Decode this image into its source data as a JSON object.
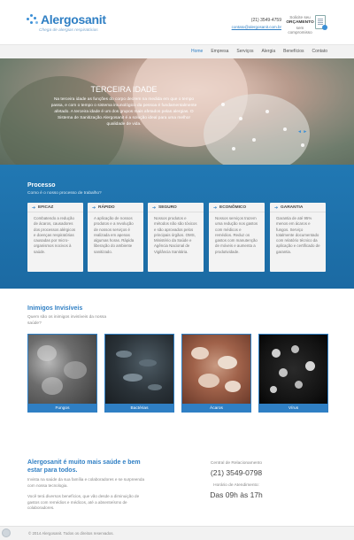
{
  "header": {
    "brand": "Alergosanit",
    "slogan": "Chega de alergias respiratórias",
    "phone": "(21) 3549-4759",
    "email": "contato@alergosanit.com.br",
    "quote_line1": "Solicite seu",
    "quote_line2": "ORÇAMENTO",
    "quote_line3": "sem compromisso",
    "quote_icon": "document-icon"
  },
  "nav": {
    "items": [
      "Home",
      "Empresa",
      "Serviços",
      "Alergia",
      "Benefícios",
      "Contato"
    ],
    "active": "Home"
  },
  "hero": {
    "title": "TERCEIRA IDADE",
    "text": "Na terceira idade as funções do corpo decrem na medida em que o tempo passa, e com o tempo o sistema imunológico da pessoa é fundamentalmente afetado. A terceira idade é um dos grupos mais afetados pelas alergias. O Sistema de Sanitização Alergosanit é a solução ideal para uma melhor qualidade de vida.",
    "arrows": "◄ ►",
    "colors": {
      "accent": "#3b8fd6"
    }
  },
  "processo": {
    "title": "Processo",
    "subtitle": "Como é o nosso processo de trabalho?",
    "cards": [
      {
        "title": "EFICAZ",
        "text": "Combatendo a redução de ácaros, causadores dos processos alérgicos e doenças respiratórias causadas por micro-organismos nocivos à saúde."
      },
      {
        "title": "RÁPIDO",
        "text": "A aplicação de nossos produtos e a revolução de nossos serviços é realizada em apenas algumas horas. Rápida liberação do ambiente sanitizado."
      },
      {
        "title": "SEGURO",
        "text": "Nossos produtos e métodos não são tóxicos e são aprovados pelos principais órgãos. OMS, Ministério da Saúde e Agência Nacional de Vigilância Sanitária."
      },
      {
        "title": "ECONÔMICO",
        "text": "Nossos serviços trazem uma redução nos gastos com médicos e remédios. Reduz os gastos com manutenção de móveis e aumenta a produtividade."
      },
      {
        "title": "GARANTIA",
        "text": "Garantia de até 95% menos em ácaros e fungos. Serviço totalmente documentado com relatório técnico da aplicação e certificado de garantia."
      }
    ]
  },
  "inimigos": {
    "title": "Inimigos Invisíveis",
    "subtitle": "Quem são os inimigos invisíveis da nossa saúde?",
    "items": [
      "Fungos",
      "Bactérias",
      "Ácaros",
      "Vírus"
    ]
  },
  "bottom": {
    "title": "Alergosanit é muito mais saúde e bem estar para todos.",
    "p1": "Invista na saúde da sua família e colaboradores e se surpreenda com nossa tecnologia.",
    "p2": "Você terá diversos benefícios, que vão desde a diminuição de gastos com remédios e médicos, até a absenteísmo de colaboradores.",
    "contact_label": "Central de Relacionamento",
    "contact_phone": "(21) 3549-0798",
    "hours_label": "Horário de Atendimento:",
    "hours": "Das 09h às 17h"
  },
  "footer": {
    "copyright": "© 2014 Alergosanit. Todos os direitos reservados."
  }
}
